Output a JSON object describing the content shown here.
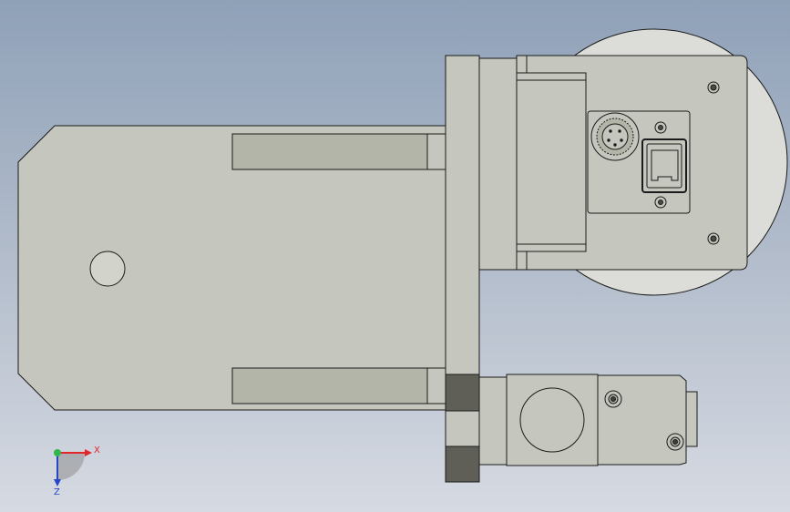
{
  "viewport": {
    "background_top": "#8fa1b8",
    "background_bottom": "#d6dae2"
  },
  "part_colors": {
    "body": "#c5c6bd",
    "slot": "#b4b5a9",
    "dark_block": "#5f5f58",
    "outline": "#1b1b1b",
    "disc": "#dcdcd8"
  },
  "triad": {
    "x_label": "X",
    "z_label": "Z",
    "x_color": "#e2262a",
    "y_color": "#2fb84a",
    "z_color": "#2646c9"
  }
}
